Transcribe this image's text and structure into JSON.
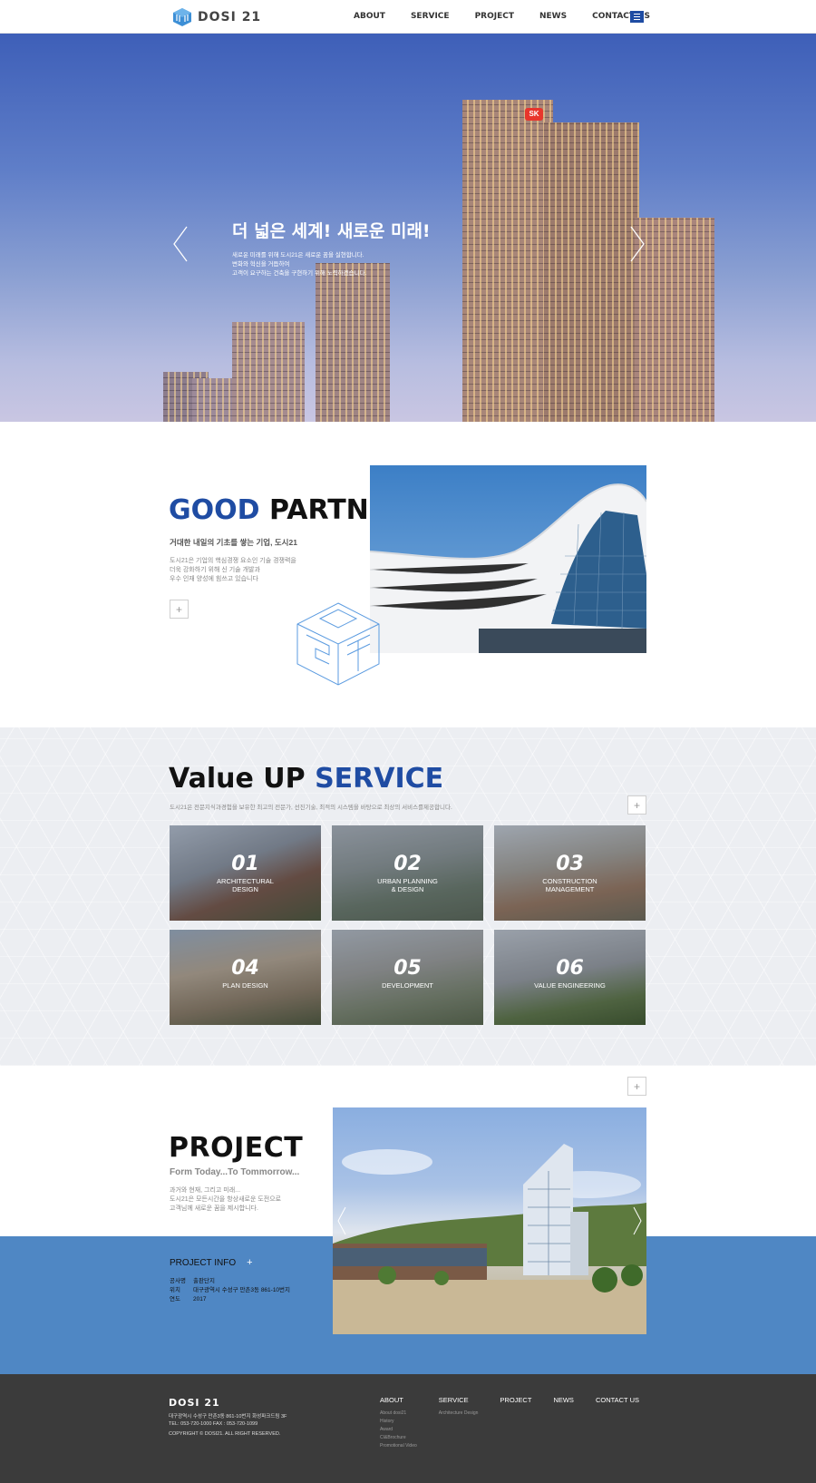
{
  "header": {
    "logo_text": "DOSI 21",
    "nav": [
      "ABOUT",
      "SERVICE",
      "PROJECT",
      "NEWS",
      "CONTACT US"
    ]
  },
  "hero": {
    "title": "더 넓은 세계! 새로운 미래!",
    "subtitle_lines": [
      "새로운 미래를 위해 도시21은 새로운 꿈을 실현합니다.",
      "변화와 혁신을 거듭하여",
      "고객이 요구하는 건축을 구현하기 위해 노력하겠습니다."
    ]
  },
  "partner": {
    "title_blue": "GOOD",
    "title_dark": "PARTNER",
    "subtitle": "거대한 내일의 기초를 쌓는 기업, 도시21",
    "desc_lines": [
      "도시21은 기업의 핵심경쟁 요소인 기술 경쟁력을",
      "더욱 강화하기 위해 신 기술 개발과",
      "우수 인재 양성에 힘쓰고 있습니다"
    ],
    "plus": "+"
  },
  "service": {
    "title_dark": "Value UP",
    "title_blue": "SERVICE",
    "desc": "도시21은 전문지식과경험을 보유한 최고의 전문가, 선진기술, 최적의 시스템을 바탕으로 최상의 서비스를제공합니다.",
    "plus": "+",
    "cards": [
      {
        "num": "01",
        "label": "ARCHITECTURAL\nDESIGN"
      },
      {
        "num": "02",
        "label": "URBAN PLANNING\n& DESIGN"
      },
      {
        "num": "03",
        "label": "CONSTRUCTION\nMANAGEMENT"
      },
      {
        "num": "04",
        "label": "PLAN DESIGN"
      },
      {
        "num": "05",
        "label": "DEVELOPMENT"
      },
      {
        "num": "06",
        "label": "VALUE ENGINEERING"
      }
    ]
  },
  "project": {
    "title": "PROJECT",
    "subtitle": "Form Today...To Tommorrow...",
    "desc_lines": [
      "과거와 현재, 그리고 미래...",
      "도시21은 모든시간을 항상새로운 도전으로",
      "고객님께 새로운 꿈을 제시합니다."
    ],
    "plus": "+",
    "info_title": "PROJECT INFO",
    "info_plus": "+",
    "info": [
      {
        "k": "공사명",
        "v": "출판단지"
      },
      {
        "k": "위치",
        "v": "대구광역시 수성구 만촌3동 861-10번지"
      },
      {
        "k": "연도",
        "v": "2017"
      }
    ]
  },
  "footer": {
    "logo": "DOSI 21",
    "address": "대구광역시 수성구 만촌3동 861-10번지 화성파크드림 3F",
    "tel": "TEL: 053-720-1000     FAX : 053-720-1099",
    "copyright": "COPYRIGHT © DOSI21. ALL RIGHT RESERVED.",
    "nav": [
      {
        "title": "ABOUT",
        "items": [
          "About dosi21",
          "History",
          "Award",
          "CI&Brochure",
          "Promotional Video"
        ]
      },
      {
        "title": "SERVICE",
        "items": [
          "Architecture Design"
        ]
      },
      {
        "title": "PROJECT",
        "items": []
      },
      {
        "title": "NEWS",
        "items": []
      },
      {
        "title": "CONTACT US",
        "items": []
      }
    ]
  },
  "colors": {
    "brand_blue": "#1f4ca3",
    "project_band": "#4f87c4",
    "footer_bg": "#3b3b3b"
  }
}
